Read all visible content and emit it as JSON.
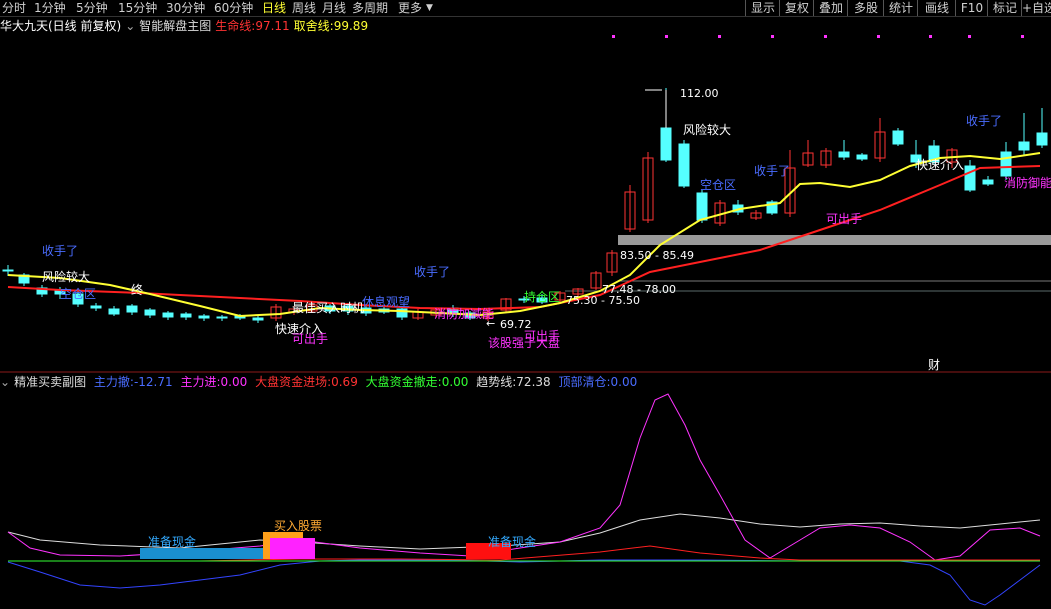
{
  "toolbar": {
    "tabs": [
      "分时",
      "1分钟",
      "5分钟",
      "15分钟",
      "30分钟",
      "60分钟",
      "日线",
      "周线",
      "月线",
      "多周期",
      "更多"
    ],
    "active_tab": "日线",
    "right_buttons": [
      "显示",
      "复权",
      "叠加",
      "多股",
      "统计",
      "画线",
      "F10",
      "标记",
      "+自选"
    ]
  },
  "main_panel": {
    "stock_name": "华大九天(日线 前复权)",
    "indicator_name": "智能解盘主图",
    "life_line_label": "生命线:",
    "life_line_value": "97.11",
    "exit_line_label": "取舍线:",
    "exit_line_value": "99.89",
    "price_labels": {
      "high": "112.00",
      "low": "69.72",
      "range1": "83.50 - 85.49",
      "range2": "77.48 - 78.00",
      "range3": "75.30 - 75.50"
    },
    "annotations": [
      {
        "text": "收手了",
        "color": "#4a6cff"
      },
      {
        "text": "风险较大",
        "color": "#ffffff"
      },
      {
        "text": "空仓区",
        "color": "#4a6cff"
      },
      {
        "text": "终",
        "color": "#ffffff"
      },
      {
        "text": "收手了",
        "color": "#4a6cff"
      },
      {
        "text": "最佳买入时机",
        "color": "#ffffff"
      },
      {
        "text": "休息观望",
        "color": "#4a6cff"
      },
      {
        "text": "快速介入",
        "color": "#ffffff"
      },
      {
        "text": "可出手",
        "color": "#ff33ff"
      },
      {
        "text": "消防加减能",
        "color": "#ff33ff"
      },
      {
        "text": "持仓区",
        "color": "#33ff33"
      },
      {
        "text": "可出手",
        "color": "#ff33ff"
      },
      {
        "text": "该股强于大盘",
        "color": "#ff33ff"
      },
      {
        "text": "风险较大",
        "color": "#ffffff"
      },
      {
        "text": "空仓区",
        "color": "#4a6cff"
      },
      {
        "text": "收手了",
        "color": "#4a6cff"
      },
      {
        "text": "可出手",
        "color": "#ff33ff"
      },
      {
        "text": "快速介入",
        "color": "#ffffff"
      },
      {
        "text": "收手了",
        "color": "#4a6cff"
      },
      {
        "text": "消防御能",
        "color": "#ff33ff"
      },
      {
        "text": "财",
        "color": "#ffffff"
      }
    ]
  },
  "sub_panel": {
    "name": "精准买卖副图",
    "metrics": [
      {
        "label": "主力撤:",
        "value": "-12.71",
        "color": "#4a6cff"
      },
      {
        "label": "主力进:",
        "value": "0.00",
        "color": "#ff33ff"
      },
      {
        "label": "大盘资金进场:",
        "value": "0.69",
        "color": "#ff3333"
      },
      {
        "label": "大盘资金撤走:",
        "value": "0.00",
        "color": "#33ff33"
      },
      {
        "label": "趋势线:",
        "value": "72.38",
        "color": "#dddddd"
      },
      {
        "label": "顶部清仓:",
        "value": "0.00",
        "color": "#4a6cff"
      }
    ],
    "labels": [
      {
        "text": "准备现金",
        "color": "#33aaff"
      },
      {
        "text": "买入股票",
        "color": "#ffaa33"
      },
      {
        "text": "准备现金",
        "color": "#33aaff"
      }
    ]
  },
  "colors": {
    "bull": "#ff3333",
    "bear": "#55ffff",
    "life_line": "#ff2020",
    "exit_line": "#ffff33",
    "trend_line": "#dddddd",
    "pink_line": "#ff33ff",
    "blue_line": "#3344ff"
  }
}
